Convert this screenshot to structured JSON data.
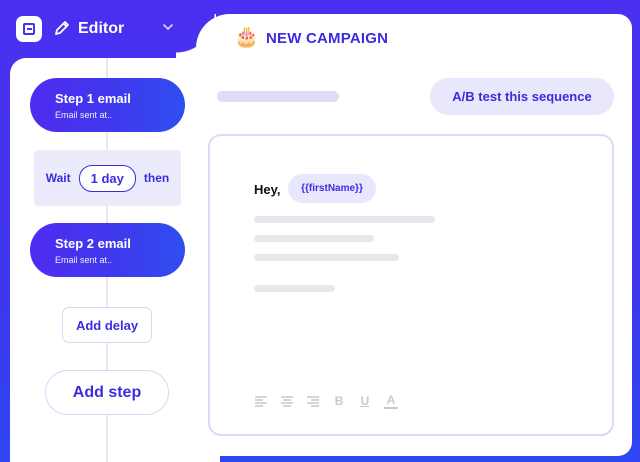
{
  "header": {
    "app_label": "Editor",
    "campaign_emoji": "🎂",
    "campaign_title": "NEW CAMPAIGN"
  },
  "sequence": {
    "steps": [
      {
        "title": "Step 1 email",
        "subtitle": "Email sent at.."
      },
      {
        "title": "Step 2 email",
        "subtitle": "Email sent at.."
      }
    ],
    "wait": {
      "prefix": "Wait",
      "duration": "1 day",
      "suffix": "then"
    },
    "add_delay_label": "Add delay",
    "add_step_label": "Add step"
  },
  "editor": {
    "ab_test_label": "A/B test this sequence",
    "greeting": "Hey,",
    "token": "{{firstName}}",
    "toolbar": [
      "align-left-icon",
      "align-center-icon",
      "align-right-icon",
      "B",
      "U",
      "A"
    ]
  },
  "colors": {
    "brand": "#3f35ee",
    "accent_text": "#3b2ce0",
    "soft_fill": "#e9e7fb"
  }
}
